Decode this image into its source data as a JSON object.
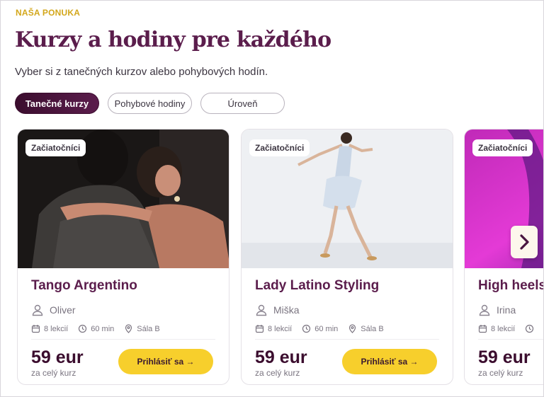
{
  "section": {
    "eyebrow": "NAŠA PONUKA",
    "title": "Kurzy a hodiny pre každého",
    "subtitle": "Vyber si z tanečných kurzov alebo pohybových hodín."
  },
  "tabs": [
    {
      "label": "Tanečné kurzy",
      "active": true
    },
    {
      "label": "Pohybové hodiny",
      "active": false
    },
    {
      "label": "Úroveň",
      "active": false
    }
  ],
  "cards": [
    {
      "badge": "Začiatočníci",
      "title": "Tango Argentino",
      "teacher": "Oliver",
      "lessons": "8 lekcií",
      "duration": "60 min",
      "room": "Sála B",
      "price": "59 eur",
      "price_note": "za celý kurz",
      "cta": "Prihlásiť sa →"
    },
    {
      "badge": "Začiatočníci",
      "title": "Lady Latino Styling",
      "teacher": "Miška",
      "lessons": "8 lekcií",
      "duration": "60 min",
      "room": "Sála B",
      "price": "59 eur",
      "price_note": "za celý kurz",
      "cta": "Prihlásiť sa →"
    },
    {
      "badge": "Začiatočníci",
      "title": "High heels",
      "teacher": "Irina",
      "lessons": "8 lekcií",
      "duration": "",
      "room": "",
      "price": "59 eur",
      "price_note": "za celý kurz",
      "cta": ""
    }
  ],
  "colors": {
    "brand": "#5b1d4c",
    "accent": "#f7cf2c",
    "eyebrow": "#d3a71b"
  },
  "icons": [
    "user-icon",
    "calendar-icon",
    "clock-icon",
    "location-pin-icon",
    "chevron-right-icon"
  ]
}
